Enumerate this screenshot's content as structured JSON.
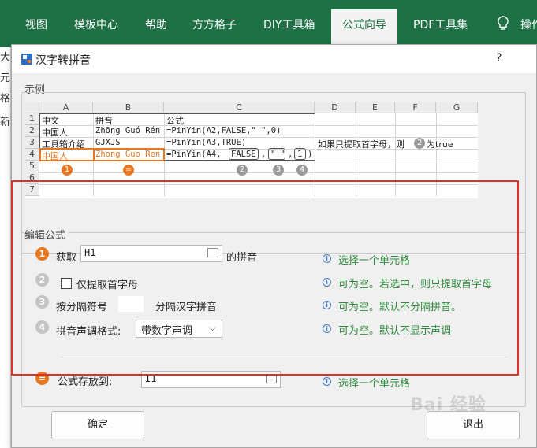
{
  "ribbon": {
    "tabs": [
      "视图",
      "模板中心",
      "帮助",
      "方方格子",
      "DIY工具箱",
      "公式向导",
      "PDF工具集",
      "操作"
    ],
    "active_tab": "公式向导"
  },
  "background_sheet": {
    "chars": [
      "大",
      "元",
      "格",
      "新"
    ]
  },
  "dialog": {
    "title": "汉字转拼音",
    "help": "?",
    "example_label": "示例",
    "edit_label": "编辑公式"
  },
  "example": {
    "col_headers": [
      "A",
      "B",
      "C",
      "D",
      "E",
      "F",
      "G"
    ],
    "row_headers": [
      "1",
      "2",
      "3",
      "4",
      "5",
      "6",
      "7"
    ],
    "rows": [
      [
        "中文",
        "拼音",
        "公式"
      ],
      [
        "中国人",
        "Zhōng Guó Rén",
        "=PinYin(A2,FALSE,\" \",0)"
      ],
      [
        "工具箱介绍",
        "GJXJS",
        "=PinYin(A3,TRUE)"
      ],
      [
        "中国人",
        "Zhong Guo Ren",
        "=PinYin(A4,"
      ]
    ],
    "row4_parts": [
      "FALSE",
      ",",
      "\" \"",
      ",",
      "1",
      ")"
    ],
    "note_prefix": "如果只提取首字母，则",
    "note_badge": "2",
    "note_suffix": "为true",
    "badges": [
      "1",
      "=",
      "2",
      "3",
      "4"
    ]
  },
  "form": {
    "step1": {
      "badge": "1",
      "label": "获取",
      "value": "H1",
      "suffix": "的拼音",
      "hint": "选择一个单元格"
    },
    "step2": {
      "badge": "2",
      "label": "仅提取首字母",
      "checked": false,
      "hint": "可为空。若选中，则只提取首字母"
    },
    "step3": {
      "badge": "3",
      "label": "按分隔符号",
      "value": "",
      "suffix": "分隔汉字拼音",
      "hint": "可为空。默认不分隔拼音。"
    },
    "step4": {
      "badge": "4",
      "label": "拼音声调格式:",
      "selected": "带数字声调",
      "hint": "可为空。默认不显示声调"
    },
    "output": {
      "badge": "=",
      "label": "公式存放到:",
      "value": "I1",
      "hint": "选择一个单元格"
    }
  },
  "buttons": {
    "ok": "确定",
    "exit": "退出"
  },
  "watermark": "Bai 经验",
  "colors": {
    "ribbon": "#1e7145",
    "accent_orange": "#e87722",
    "highlight_red": "#e0302a",
    "hint_green": "#2e8b3d"
  }
}
